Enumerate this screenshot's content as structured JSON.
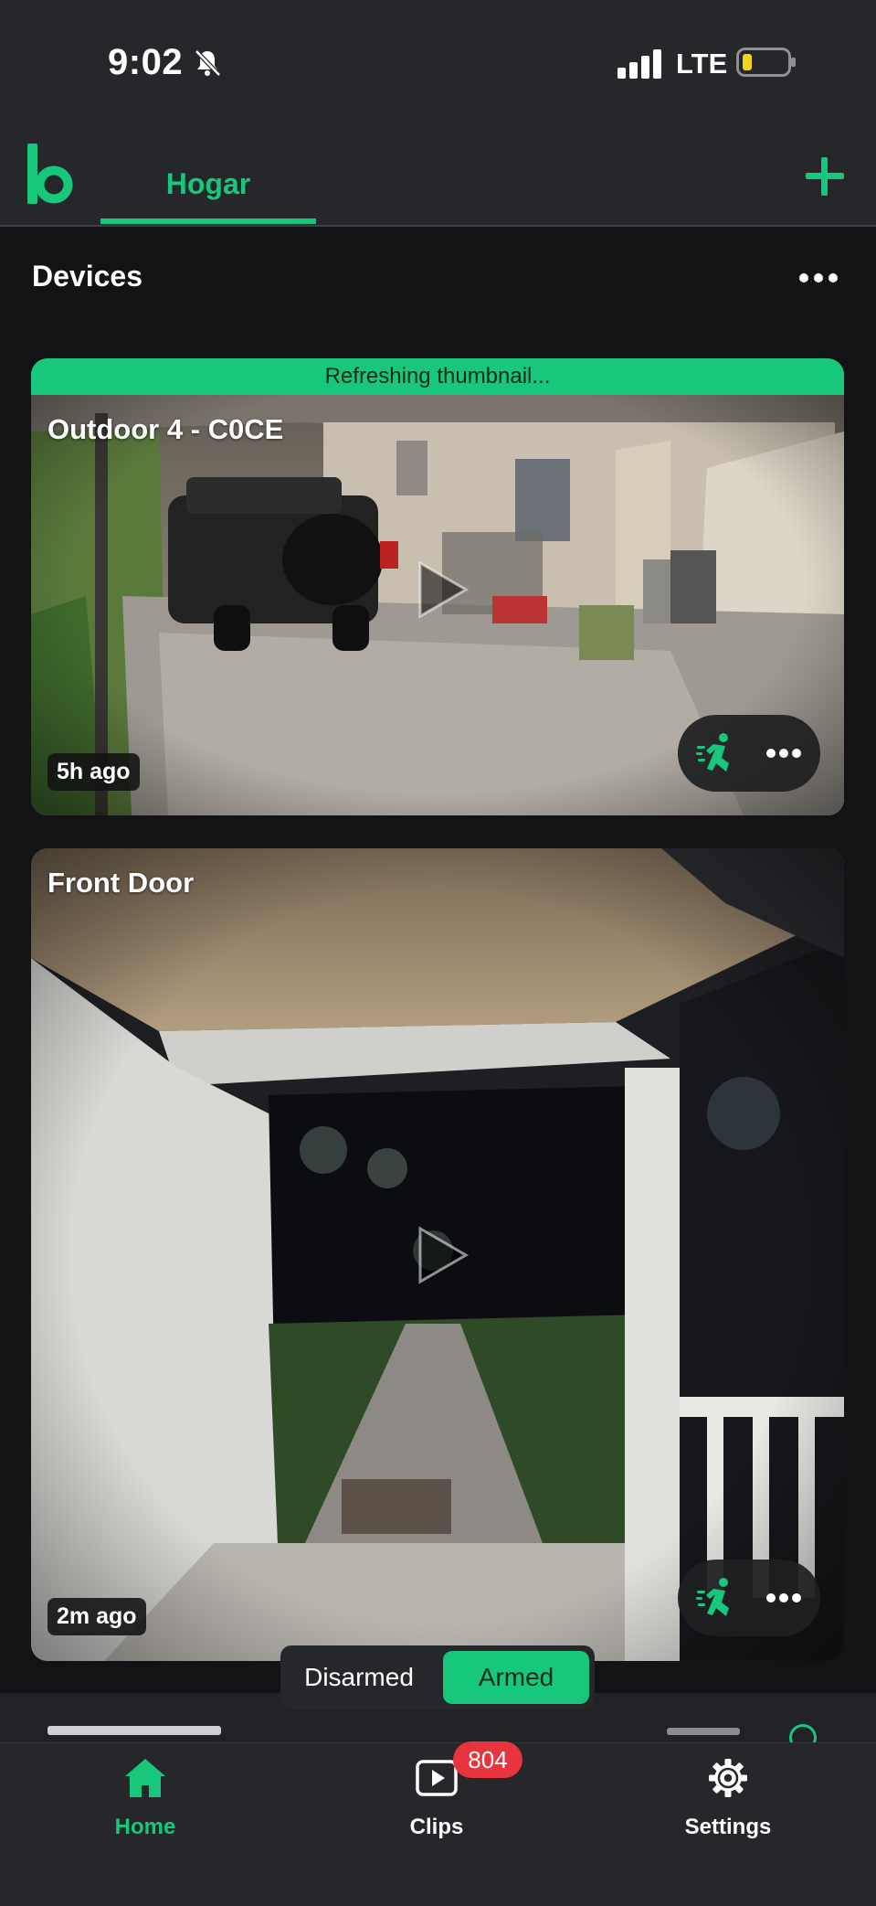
{
  "status_bar": {
    "time": "9:02",
    "network": "LTE",
    "icons": [
      "bell-slash-icon",
      "cellular-signal-icon",
      "battery-low-icon"
    ]
  },
  "header": {
    "logo": "b",
    "tab_label": "Hogar",
    "add_icon": "plus-icon"
  },
  "devices": {
    "title": "Devices",
    "menu_icon": "ellipsis-icon"
  },
  "cameras": [
    {
      "name": "Outdoor 4 - C0CE",
      "banner": "Refreshing thumbnail...",
      "last_update": "5h ago",
      "motion_icon": "motion-detection-icon",
      "menu_icon": "ellipsis-icon"
    },
    {
      "name": "Front Door",
      "last_update": "2m ago",
      "motion_icon": "motion-detection-icon",
      "menu_icon": "ellipsis-icon"
    }
  ],
  "mode_toggle": {
    "disarmed_label": "Disarmed",
    "armed_label": "Armed",
    "selected": "Armed"
  },
  "tab_bar": {
    "home_label": "Home",
    "clips_label": "Clips",
    "clips_badge": "804",
    "settings_label": "Settings"
  },
  "colors": {
    "accent": "#17c77b",
    "background": "#121314",
    "surface": "#25272b",
    "badge": "#e8343f"
  }
}
